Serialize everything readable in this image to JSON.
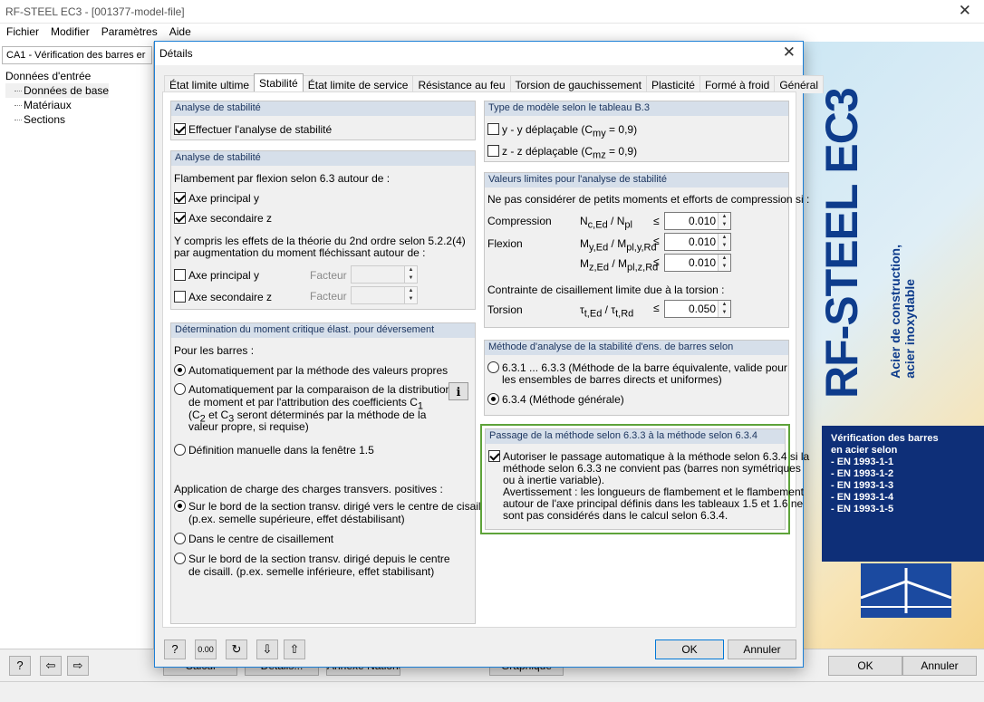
{
  "app": {
    "title": "RF-STEEL EC3 - [001377-model-file]"
  },
  "menu": [
    "Fichier",
    "Modifier",
    "Paramètres",
    "Aide"
  ],
  "left": {
    "case": "CA1 - Vérification des barres er",
    "tree": {
      "root": "Données d'entrée",
      "children": [
        "Données de base",
        "Matériaux",
        "Sections"
      ]
    }
  },
  "brand": {
    "big": "RF-STEEL EC3",
    "sub1": "Acier de construction,",
    "sub2": "acier inoxydable",
    "box_title1": "Vérification des barres",
    "box_title2": "en acier selon",
    "norms": [
      "- EN 1993-1-1",
      "- EN 1993-1-2",
      "- EN 1993-1-3",
      "- EN 1993-1-4",
      "- EN 1993-1-5"
    ]
  },
  "bottom": {
    "calc": "Calcul",
    "details": "Détails...",
    "annex": "Annexe Nationale...",
    "graphic": "Graphique",
    "ok": "OK",
    "cancel": "Annuler"
  },
  "dialog": {
    "title": "Détails",
    "tabs": [
      "État limite ultime",
      "Stabilité",
      "État limite de service",
      "Résistance au feu",
      "Torsion de gauchissement",
      "Plasticité",
      "Formé à froid",
      "Général"
    ],
    "active_tab": "Stabilité",
    "g1": {
      "header": "Analyse de stabilité",
      "check": "Effectuer l'analyse de stabilité"
    },
    "g2": {
      "header": "Analyse de stabilité",
      "intro": "Flambement par flexion selon 6.3 autour de :",
      "axis_y": "Axe principal y",
      "axis_z": "Axe secondaire z",
      "second_order1": "Y compris les effets de la théorie du 2nd ordre selon 5.2.2(4)",
      "second_order2": "par augmentation du moment fléchissant autour de :",
      "m_axis_y": "Axe principal y",
      "m_axis_z": "Axe secondaire z",
      "factor": "Facteur"
    },
    "g3": {
      "header": "Détermination du moment critique élast. pour déversement",
      "for_bars": "Pour les barres :",
      "opt1": "Automatiquement par la méthode des valeurs propres",
      "opt2a": "Automatiquement par la comparaison de la distribution",
      "opt2b": "de moment et par l'attribution des coefficients C",
      "opt2c": "(C",
      "opt2d": " et C",
      "opt2e": " seront déterminés par la méthode de la",
      "opt2f": "valeur propre, si requise)",
      "opt3": "Définition manuelle dans la fenêtre 1.5",
      "load_title": "Application de charge des charges transvers. positives :",
      "load1a": "Sur le bord de la section transv. dirigé vers le centre de cisaill.",
      "load1b": "(p.ex. semelle supérieure, effet déstabilisant)",
      "load2": "Dans le centre de cisaillement",
      "load3a": "Sur le bord de la section transv. dirigé depuis le centre",
      "load3b": "de cisaill. (p.ex. semelle inférieure, effet stabilisant)"
    },
    "g4": {
      "header": "Type de modèle selon le tableau B.3",
      "y": "y - y déplaçable (C",
      "y_sub": "my",
      "y_end": " = 0,9)",
      "z": "z - z déplaçable (C",
      "z_sub": "mz",
      "z_end": " = 0,9)"
    },
    "g5": {
      "header": "Valeurs limites pour l'analyse de stabilité",
      "intro": "Ne pas considérer de petits moments et efforts de compression si :",
      "compression": "Compression",
      "flexion": "Flexion",
      "shear": "Contrainte de cisaillement limite due à la torsion :",
      "torsion": "Torsion",
      "le": "≤",
      "v1": "0.010",
      "v2": "0.010",
      "v3": "0.010",
      "v4": "0.050"
    },
    "g6": {
      "header": "Méthode d'analyse de la stabilité d'ens. de barres selon",
      "opt1a": "6.3.1 ... 6.3.3 (Méthode de la barre équivalente, valide pour",
      "opt1b": "les ensembles de barres directs et uniformes)",
      "opt2": "6.3.4  (Méthode générale)"
    },
    "g7": {
      "header": "Passage de la méthode selon 6.3.3 à la méthode selon 6.3.4",
      "l1": "Autoriser le passage automatique à la méthode selon 6.3.4 si la",
      "l2": "méthode selon 6.3.3 ne convient pas (barres non symétriques",
      "l3": "ou à inertie variable).",
      "l4": "Avertissement : les longueurs de flambement et le flambement",
      "l5": "autour de l'axe principal définis dans les tableaux 1.5 et 1.6 ne",
      "l6": "sont pas considérés dans le calcul selon 6.3.4."
    },
    "ok": "OK",
    "cancel": "Annuler"
  }
}
